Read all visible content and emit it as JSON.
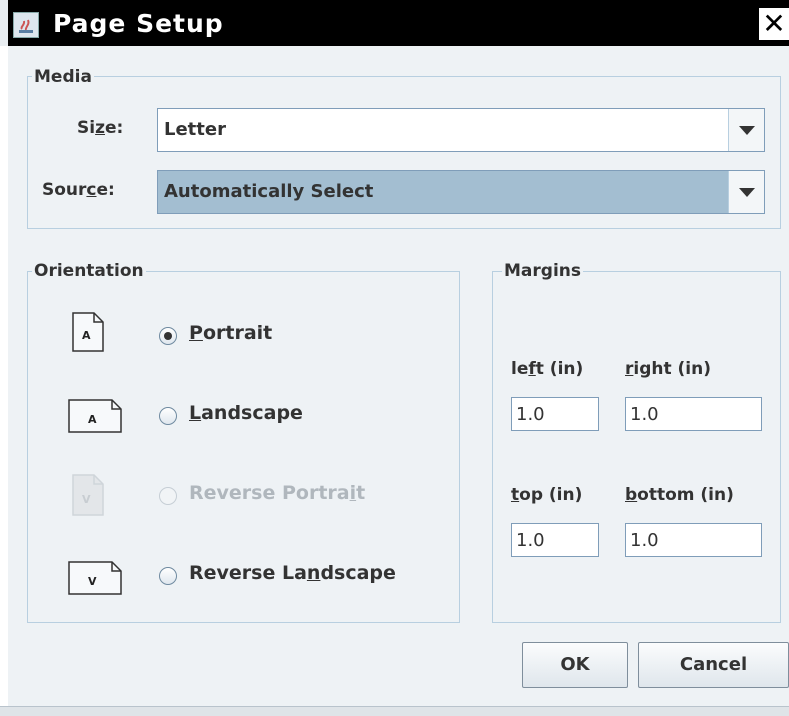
{
  "window": {
    "title": "Page Setup",
    "close_glyph": "✕",
    "icon": "java-app-icon"
  },
  "media": {
    "legend": "Media",
    "size": {
      "label_pre": "Si",
      "label_mnemonic": "z",
      "label_post": "e:",
      "value": "Letter"
    },
    "source": {
      "label_pre": "Sour",
      "label_mnemonic": "c",
      "label_post": "e:",
      "value": "Automatically Select"
    }
  },
  "orientation": {
    "legend": "Orientation",
    "options": [
      {
        "label_pre": "",
        "label_mnemonic": "P",
        "label_post": "ortrait",
        "checked": true,
        "disabled": false,
        "icon_letter": "A"
      },
      {
        "label_pre": "",
        "label_mnemonic": "L",
        "label_post": "andscape",
        "checked": false,
        "disabled": false,
        "icon_letter": "A"
      },
      {
        "label_pre": "Reverse Portra",
        "label_mnemonic": "i",
        "label_post": "t",
        "checked": false,
        "disabled": true,
        "icon_letter": "V"
      },
      {
        "label_pre": "Reverse La",
        "label_mnemonic": "n",
        "label_post": "dscape",
        "checked": false,
        "disabled": false,
        "icon_letter": "V"
      }
    ]
  },
  "margins": {
    "legend": "Margins",
    "left": {
      "label_pre": "le",
      "label_mnemonic": "f",
      "label_post": "t (in)",
      "value": "1.0"
    },
    "right": {
      "label_pre": "",
      "label_mnemonic": "r",
      "label_post": "ight (in)",
      "value": "1.0"
    },
    "top": {
      "label_pre": "",
      "label_mnemonic": "t",
      "label_post": "op (in)",
      "value": "1.0"
    },
    "bottom": {
      "label_pre": "",
      "label_mnemonic": "b",
      "label_post": "ottom (in)",
      "value": "1.0"
    }
  },
  "buttons": {
    "ok": "OK",
    "cancel": "Cancel"
  },
  "colors": {
    "dialog_bg": "#eef2f5",
    "border": "#b8cfe0",
    "selected_combo": "#a3bed1"
  }
}
